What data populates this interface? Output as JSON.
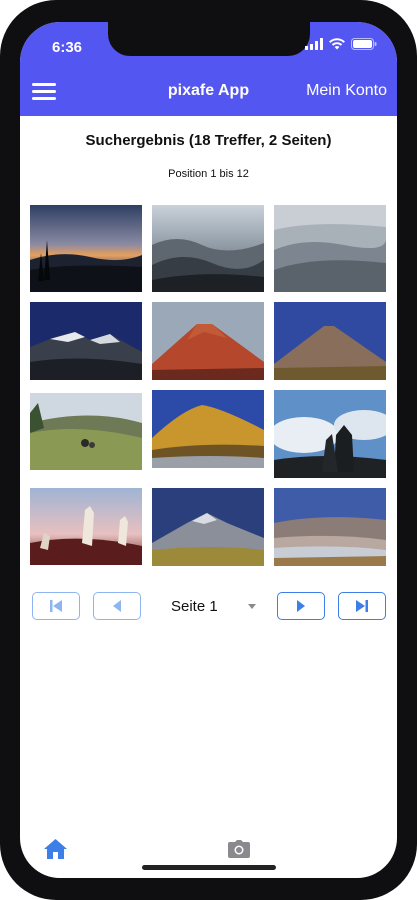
{
  "status": {
    "time": "6:36"
  },
  "header": {
    "title": "pixafe App",
    "account_label": "Mein Konto"
  },
  "results": {
    "title": "Suchergebnis (18 Treffer, 2 Seiten)",
    "position_text": "Position 1 bis 12"
  },
  "pager": {
    "page_label": "Seite 1"
  },
  "colors": {
    "accent": "#5356f0",
    "button_blue": "#3d7ee8"
  },
  "tabbar": {
    "items": [
      {
        "icon": "home-icon"
      },
      {
        "icon": "camera-icon"
      }
    ]
  }
}
